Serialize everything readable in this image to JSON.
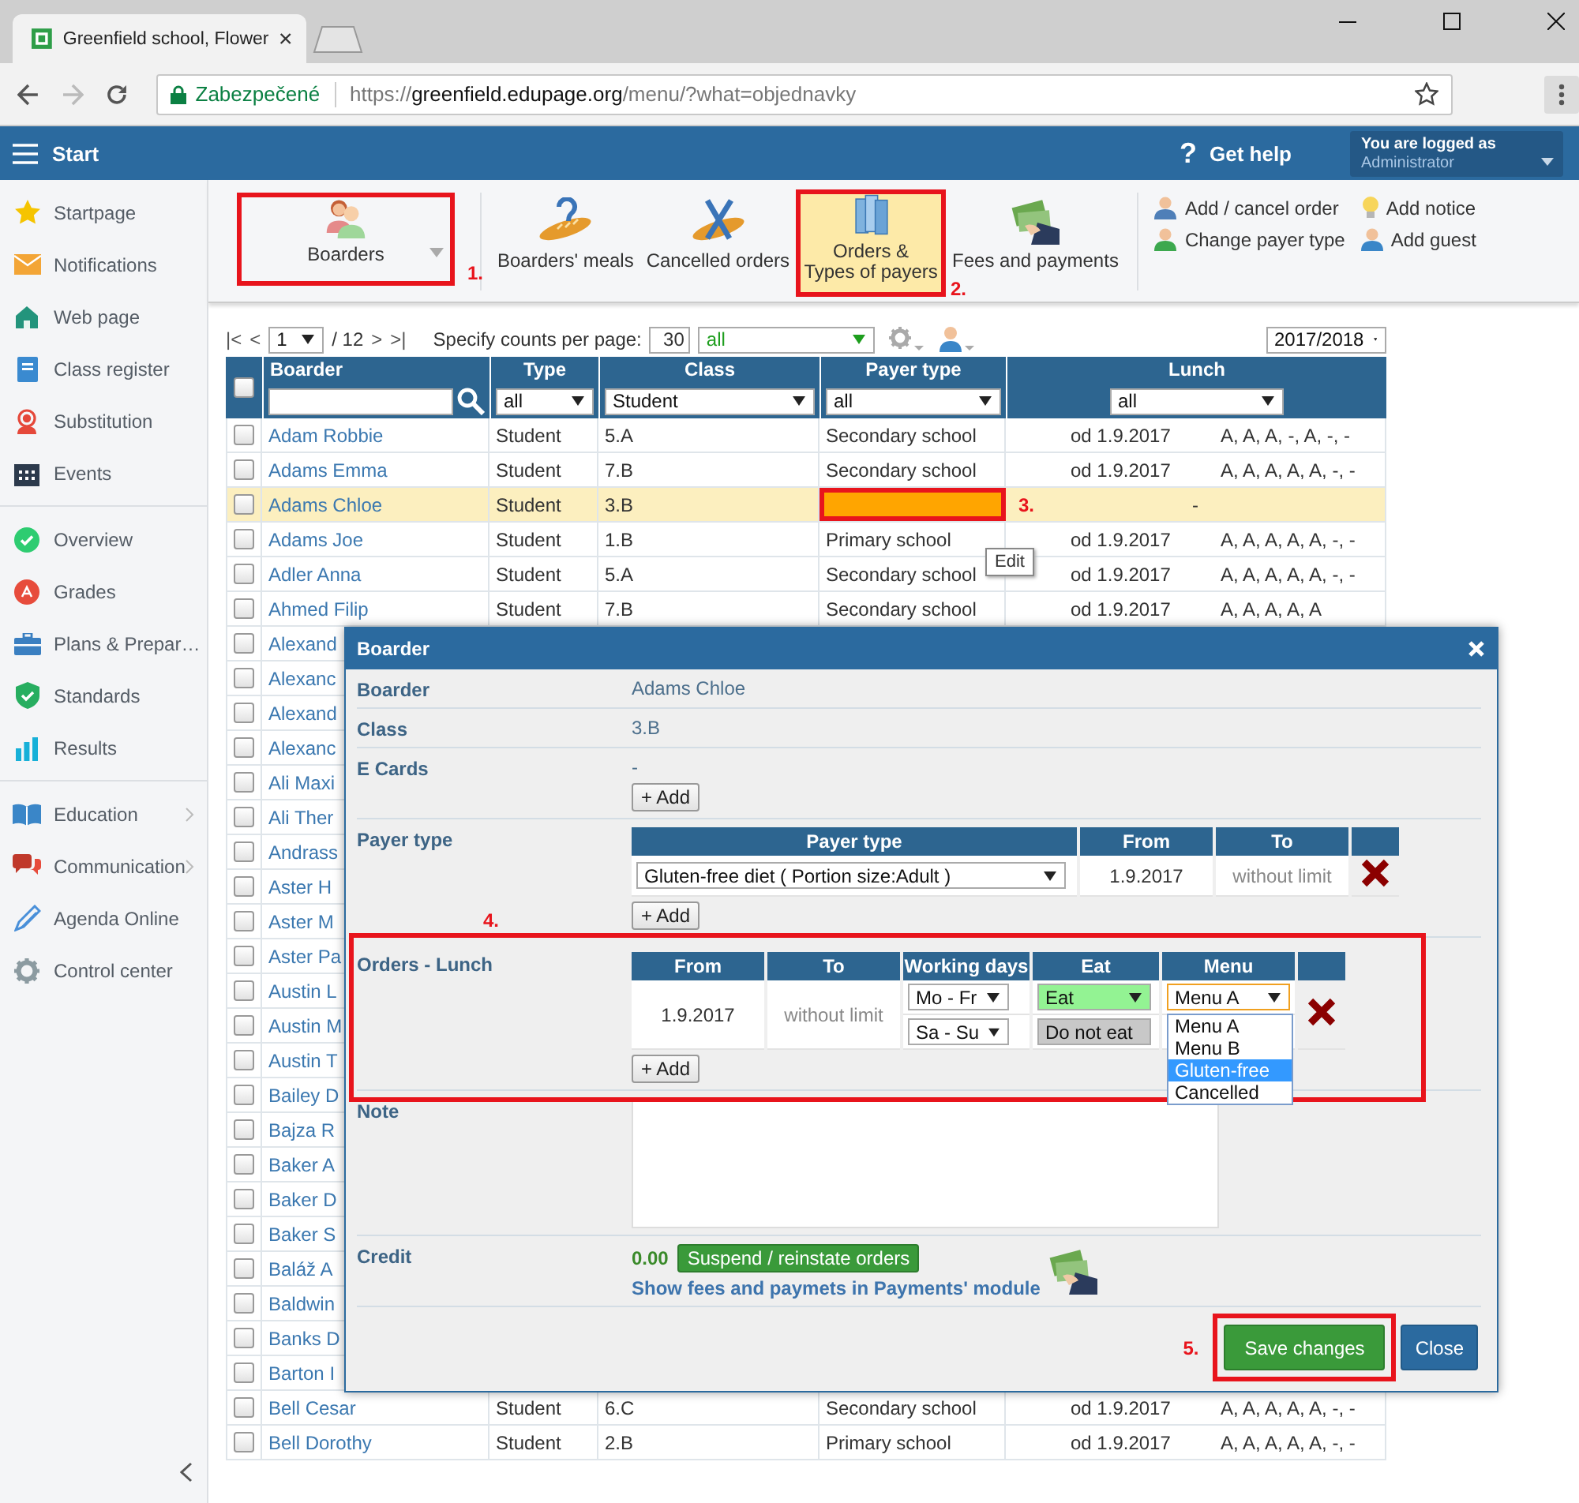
{
  "browser": {
    "tab_title": "Greenfield school, Flower",
    "security": "Zabezpečené",
    "url": {
      "scheme": "https://",
      "host": "greenfield.edupage.org",
      "path": "/menu/?what=objednavky"
    }
  },
  "header": {
    "menu_label": "Start",
    "help_mark": "?",
    "help": "Get help",
    "login": {
      "caption": "You are logged as",
      "user": "Administrator"
    }
  },
  "sidebar": {
    "groups": [
      [
        {
          "label": "Startpage",
          "submenu": false
        },
        {
          "label": "Notifications",
          "submenu": false
        },
        {
          "label": "Web page",
          "submenu": false
        },
        {
          "label": "Class register",
          "submenu": false
        },
        {
          "label": "Substitution",
          "submenu": false
        },
        {
          "label": "Events",
          "submenu": false
        }
      ],
      [
        {
          "label": "Overview",
          "submenu": false
        },
        {
          "label": "Grades",
          "submenu": false
        },
        {
          "label": "Plans & Prepar…",
          "submenu": false
        },
        {
          "label": "Standards",
          "submenu": false
        },
        {
          "label": "Results",
          "submenu": false
        }
      ],
      [
        {
          "label": "Education",
          "submenu": true
        },
        {
          "label": "Communication",
          "submenu": true
        },
        {
          "label": "Agenda Online",
          "submenu": false
        },
        {
          "label": "Control center",
          "submenu": false
        }
      ]
    ]
  },
  "toolbar": {
    "items": [
      {
        "label": "Boarders",
        "selected": false,
        "dropdown": true
      },
      {
        "label": "Boarders' meals",
        "selected": false,
        "dropdown": false
      },
      {
        "label": "Cancelled orders",
        "selected": false,
        "dropdown": false
      },
      {
        "label": "Orders &\nTypes of payers",
        "selected": true,
        "dropdown": false
      },
      {
        "label": "Fees and payments",
        "selected": false,
        "dropdown": false
      }
    ],
    "actions": [
      {
        "label": "Add / cancel order"
      },
      {
        "label": "Add notice"
      },
      {
        "label": "Change payer type"
      },
      {
        "label": "Add guest"
      }
    ]
  },
  "pager": {
    "first": "|<",
    "prev": "<",
    "page": "1",
    "total": "/ 12",
    "next": ">",
    "last": ">|",
    "counts_label": "Specify counts per page:",
    "counts": "30",
    "filter": "all",
    "year": "2017/2018"
  },
  "table": {
    "all_checked": false,
    "columns": [
      "Boarder",
      "Type",
      "Class",
      "Payer type",
      "Lunch"
    ],
    "filters": {
      "type": "all",
      "class": "Student",
      "payer": "all",
      "lunch": "all"
    },
    "rows": [
      {
        "name": "Adam Robbie",
        "type": "Student",
        "class": "5.A",
        "payer": "Secondary school",
        "lunch_from": "od 1.9.2017",
        "lunch_days": "A, A, A, -, A, -, -",
        "selected": false,
        "checked": false
      },
      {
        "name": "Adams Emma",
        "type": "Student",
        "class": "7.B",
        "payer": "Secondary school",
        "lunch_from": "od 1.9.2017",
        "lunch_days": "A, A, A, A, A, -, -",
        "selected": false,
        "checked": false
      },
      {
        "name": "Adams Chloe",
        "type": "Student",
        "class": "3.B",
        "lunch": "-",
        "selected": true,
        "checked": false
      },
      {
        "name": "Adams Joe",
        "type": "Student",
        "class": "1.B",
        "payer": "Primary school",
        "lunch_from": "od 1.9.2017",
        "lunch_days": "A, A, A, A, A, -, -",
        "selected": false,
        "checked": false
      },
      {
        "name": "Adler Anna",
        "type": "Student",
        "class": "5.A",
        "payer": "Secondary school",
        "lunch_from": "od 1.9.2017",
        "lunch_days": "A, A, A, A, A, -, -",
        "selected": false,
        "checked": false
      },
      {
        "name": "Ahmed Filip",
        "type": "Student",
        "class": "7.B",
        "payer": "Secondary school",
        "lunch_from": "od 1.9.2017",
        "lunch_days": "A, A, A, A, A",
        "selected": false,
        "checked": false
      },
      {
        "name": "Alexand",
        "selected": false,
        "checked": false
      },
      {
        "name": "Alexanc",
        "selected": false,
        "checked": false
      },
      {
        "name": "Alexand",
        "selected": false,
        "checked": false
      },
      {
        "name": "Alexanc",
        "selected": false,
        "checked": false
      },
      {
        "name": "Ali Maxi",
        "selected": false,
        "checked": false
      },
      {
        "name": "Ali Ther",
        "selected": false,
        "checked": false
      },
      {
        "name": "Andrass",
        "selected": false,
        "checked": false
      },
      {
        "name": "Aster H",
        "selected": false,
        "checked": false
      },
      {
        "name": "Aster M",
        "selected": false,
        "checked": false
      },
      {
        "name": "Aster Pa",
        "selected": false,
        "checked": false
      },
      {
        "name": "Austin L",
        "selected": false,
        "checked": false
      },
      {
        "name": "Austin M",
        "selected": false,
        "checked": false
      },
      {
        "name": "Austin T",
        "selected": false,
        "checked": false
      },
      {
        "name": "Bailey D",
        "selected": false,
        "checked": false
      },
      {
        "name": "Bajza R",
        "selected": false,
        "checked": false
      },
      {
        "name": "Baker A",
        "selected": false,
        "checked": false
      },
      {
        "name": "Baker D",
        "selected": false,
        "checked": false
      },
      {
        "name": "Baker S",
        "selected": false,
        "checked": false
      },
      {
        "name": "Baláž A",
        "selected": false,
        "checked": false
      },
      {
        "name": "Baldwin",
        "selected": false,
        "checked": false
      },
      {
        "name": "Banks D",
        "selected": false,
        "checked": false
      },
      {
        "name": "Barton I",
        "selected": false,
        "checked": false
      },
      {
        "name": "Bell Cesar",
        "type": "Student",
        "class": "6.C",
        "payer": "Secondary school",
        "lunch_from": "od 1.9.2017",
        "lunch_days": "A, A, A, A, A, -, -",
        "selected": false,
        "checked": false
      },
      {
        "name": "Bell Dorothy",
        "type": "Student",
        "class": "2.B",
        "payer": "Primary school",
        "lunch_from": "od 1.9.2017",
        "lunch_days": "A, A, A, A, A, -, -",
        "selected": false,
        "checked": false
      }
    ]
  },
  "tooltip": "Edit",
  "annotations": [
    "1.",
    "2.",
    "3.",
    "4.",
    "5."
  ],
  "dialog": {
    "title": "Boarder",
    "fields": [
      {
        "label": "Boarder",
        "value": "Adams Chloe"
      },
      {
        "label": "Class",
        "value": "3.B"
      }
    ],
    "ecards": {
      "label": "E Cards",
      "value": "-",
      "add": "+ Add"
    },
    "payer_type": {
      "label": "Payer type",
      "columns": [
        "Payer type",
        "From",
        "To"
      ],
      "rows": [
        {
          "type": "Gluten-free diet ( Portion size:Adult )",
          "from": "1.9.2017",
          "to": "without limit"
        }
      ],
      "add": "+ Add"
    },
    "orders": {
      "label": "Orders - Lunch",
      "columns": [
        "From",
        "To",
        "Working days",
        "Eat",
        "Menu"
      ],
      "rows": [
        {
          "from": "1.9.2017",
          "to": "without limit",
          "days": [
            {
              "days": "Mo - Fr",
              "eat_label": "Eat",
              "eat": true,
              "menu": "Menu A",
              "menu_options": [
                {
                  "label": "Menu A",
                  "selected": false
                },
                {
                  "label": "Menu B",
                  "selected": false
                },
                {
                  "label": "Gluten-free",
                  "selected": true
                },
                {
                  "label": "Cancelled",
                  "selected": false
                }
              ]
            },
            {
              "days": "Sa - Su",
              "eat_label": "Do not eat",
              "eat": false
            }
          ]
        }
      ],
      "add": "+ Add"
    },
    "note": {
      "label": "Note"
    },
    "credit": {
      "label": "Credit",
      "amount": "0.00",
      "suspend": "Suspend / reinstate orders",
      "link": "Show fees and paymets in Payments' module"
    },
    "buttons": {
      "save": "Save changes",
      "close": "Close"
    }
  }
}
